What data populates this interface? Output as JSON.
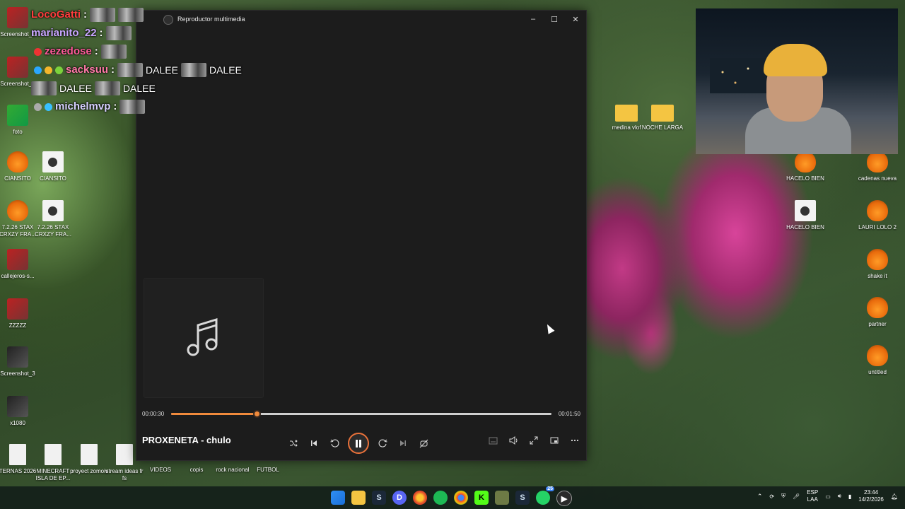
{
  "window": {
    "title": "Reproductor multimedia",
    "minimize": "–",
    "maximize": "☐",
    "close": "✕"
  },
  "player": {
    "track_title": "PROXENETA - chulo",
    "elapsed": "00:00:30",
    "duration": "00:01:50",
    "progress_percent": 22.5,
    "accent_color": "#f08a3c"
  },
  "chat": [
    {
      "user": "LocoGatti",
      "color": "#ff3d3d",
      "text": ""
    },
    {
      "user": "marianito_22",
      "color": "#c9a6ff",
      "text": ""
    },
    {
      "user": "zezedose",
      "color": "#ff5a9a",
      "text": ""
    },
    {
      "user": "sacksuu",
      "color": "#ff7aa8",
      "text": "DALEE"
    },
    {
      "user": "",
      "color": "#ffffff",
      "text": "DALEE"
    },
    {
      "user": "michelmvp",
      "color": "#d6d0ff",
      "text": ""
    }
  ],
  "chat_extra": {
    "line4_second": "DALEE",
    "line5_second": "DALEE"
  },
  "desktop_left": [
    {
      "label": "Screenshot_1",
      "kind": "thumb"
    },
    {
      "label": "Screenshot_2",
      "kind": "thumb"
    },
    {
      "label": "foto",
      "kind": "thumb2"
    },
    {
      "label": "CIANSITO",
      "kind": "fl"
    },
    {
      "label": "CIANSITO",
      "kind": "doc"
    },
    {
      "label": "7.2.26 STAX CRXZY FRA...",
      "kind": "fl"
    },
    {
      "label": "7.2.26 STAX CRXZY FRA...",
      "kind": "doc"
    },
    {
      "label": "callejeros-s...",
      "kind": "thumb"
    },
    {
      "label": "ZZZZZ",
      "kind": "thumb"
    },
    {
      "label": "Screenshot_3",
      "kind": "thumb3"
    },
    {
      "label": "x1080",
      "kind": "thumb3"
    }
  ],
  "desktop_bottom": [
    {
      "label": "TERNAS 2026",
      "kind": "file"
    },
    {
      "label": "MINECRAFT ISLA DE EP...",
      "kind": "file"
    },
    {
      "label": "proyect zomoiv",
      "kind": "file"
    },
    {
      "label": "stream ideas fr fs",
      "kind": "file"
    },
    {
      "label": "VIDEOS",
      "kind": "none"
    },
    {
      "label": "copis",
      "kind": "none"
    },
    {
      "label": "rock nacional",
      "kind": "none"
    },
    {
      "label": "FUTBOL",
      "kind": "none"
    }
  ],
  "desktop_right": [
    {
      "label": "medina vlof",
      "kind": "folder"
    },
    {
      "label": "NOCHE LARGA",
      "kind": "folder"
    },
    {
      "label": "HACELO BIEN",
      "kind": "fl"
    },
    {
      "label": "cadenas nueva",
      "kind": "fl"
    },
    {
      "label": "HACELO BIEN",
      "kind": "doc"
    },
    {
      "label": "LAURI LOLO 2",
      "kind": "fl"
    },
    {
      "label": "shake it",
      "kind": "fl"
    },
    {
      "label": "partner",
      "kind": "fl"
    },
    {
      "label": "untitled",
      "kind": "fl"
    }
  ],
  "taskbar": {
    "icons": [
      "windows-icon",
      "file-explorer-icon",
      "steam-icon",
      "discord-icon",
      "chrome-canary-icon",
      "spotify-icon",
      "chrome-icon",
      "kick-icon",
      "app-icon",
      "steam-icon-2",
      "whatsapp-icon",
      "media-player-icon"
    ],
    "whatsapp_badge": "25",
    "language_top": "ESP",
    "language_bottom": "LAA",
    "time": "23:44",
    "date": "14/2/2026"
  }
}
